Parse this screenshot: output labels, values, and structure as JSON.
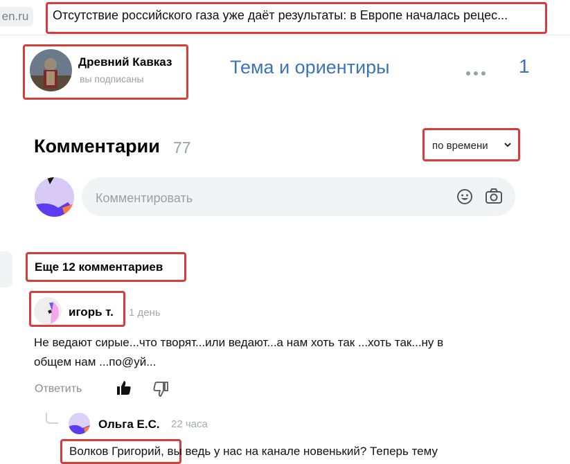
{
  "topbar": {
    "domain": "en.ru",
    "news_title": "Отсутствие российского газа уже даёт результаты: в Европе началась рецес..."
  },
  "channel": {
    "name": "Древний Кавказ",
    "status": "вы подписаны",
    "topic": "Тема и ориентиры",
    "more_icon": "more-dots-icon",
    "right_count": "1"
  },
  "comments": {
    "title": "Комментарии",
    "count": "77",
    "sort_label": "по времени",
    "input_placeholder": "Комментировать",
    "more_label": "Еще 12 комментариев"
  },
  "comment": {
    "author": "игорь т.",
    "time": "1 день",
    "text_line1": "Не ведают сирые...что творят...или ведают...а нам хоть так ...хоть так...ну в",
    "text_line2": "общем нам ...по@уй...",
    "reply_label": "Ответить"
  },
  "reply": {
    "author": "Ольга Е.С.",
    "time": "22 часа",
    "mention": "Волков Григорий",
    "text_rest": ", вы ведь у нас на канале новенький? Теперь тему"
  },
  "colors": {
    "accent_blue": "#3b74b8",
    "highlight_red": "#d93b3b",
    "muted": "#9aa0a6"
  }
}
